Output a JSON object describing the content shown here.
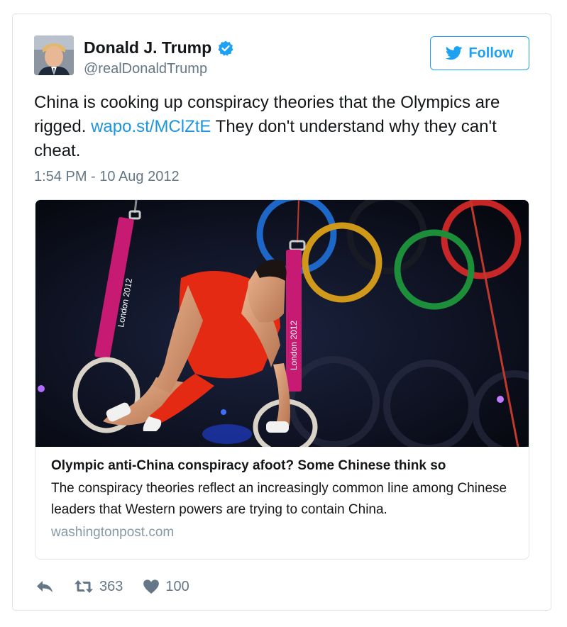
{
  "tweet": {
    "author": {
      "name": "Donald J. Trump",
      "handle": "@realDonaldTrump",
      "verified": true
    },
    "follow_label": "Follow",
    "text": {
      "before_link": "China is cooking up conspiracy theories that the Olympics are rigged. ",
      "link": "wapo.st/MClZtE",
      "after_link": " They don't understand why they can't cheat."
    },
    "timestamp": "1:54 PM - 10 Aug 2012"
  },
  "card": {
    "image_labels": {
      "strap_left": "London 2012",
      "strap_right": "London 2012"
    },
    "title": "Olympic anti-China conspiracy afoot? Some Chinese think so",
    "description": "The conspiracy theories reflect an increasingly common line among Chinese leaders that Western powers are trying to contain China.",
    "domain": "washingtonpost.com"
  },
  "actions": {
    "reply_icon": "reply-icon",
    "retweet_icon": "retweet-icon",
    "retweet_count": "363",
    "like_icon": "heart-icon",
    "like_count": "100"
  },
  "colors": {
    "accent": "#1da1f2",
    "link": "#1b95e0",
    "muted": "#657786"
  }
}
